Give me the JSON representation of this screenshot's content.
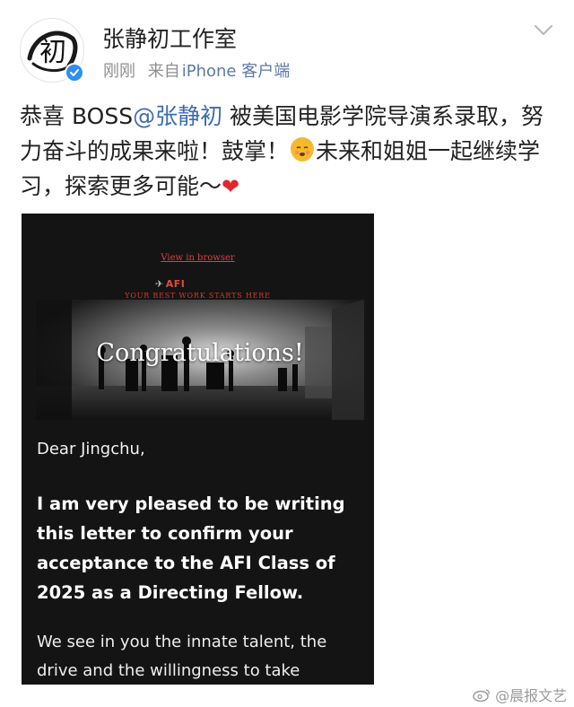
{
  "post": {
    "author": {
      "name": "张静初工作室",
      "avatar_text": "初",
      "verified": true
    },
    "meta": {
      "time": "刚刚",
      "source_prefix": "来自",
      "source_device": "iPhone 客户端"
    },
    "text": {
      "part1": "恭喜 BOSS",
      "mention": "@张静初",
      "part2": " 被美国电影学院导演系录取，努力奋斗的成果来啦！鼓掌！",
      "part3": "未来和姐姐一起继续学习，探索更多可能～"
    },
    "emoji": [
      "blush-icon",
      "heart-icon"
    ]
  },
  "letter": {
    "view_in_browser": "View in browser",
    "logo": "AFI",
    "tagline": "YOUR BEST WORK STARTS HERE",
    "hero_title": "Congratulations!",
    "salutation": "Dear Jingchu,",
    "bold_paragraph": "I am very pleased to be writing this letter to confirm your acceptance to the AFI Class of 2025 as a Directing Fellow.",
    "body_paragraph": "We see in you the innate talent, the drive and the willingness to take"
  },
  "watermark": {
    "text": "@晨报文艺"
  },
  "colors": {
    "mention": "#3b6cb0",
    "meta_gray": "#8e8e8e",
    "device_link": "#5b7aa6",
    "letter_bg": "#141414",
    "afi_red": "#d9413a",
    "verified_blue": "#2f8ff0"
  }
}
